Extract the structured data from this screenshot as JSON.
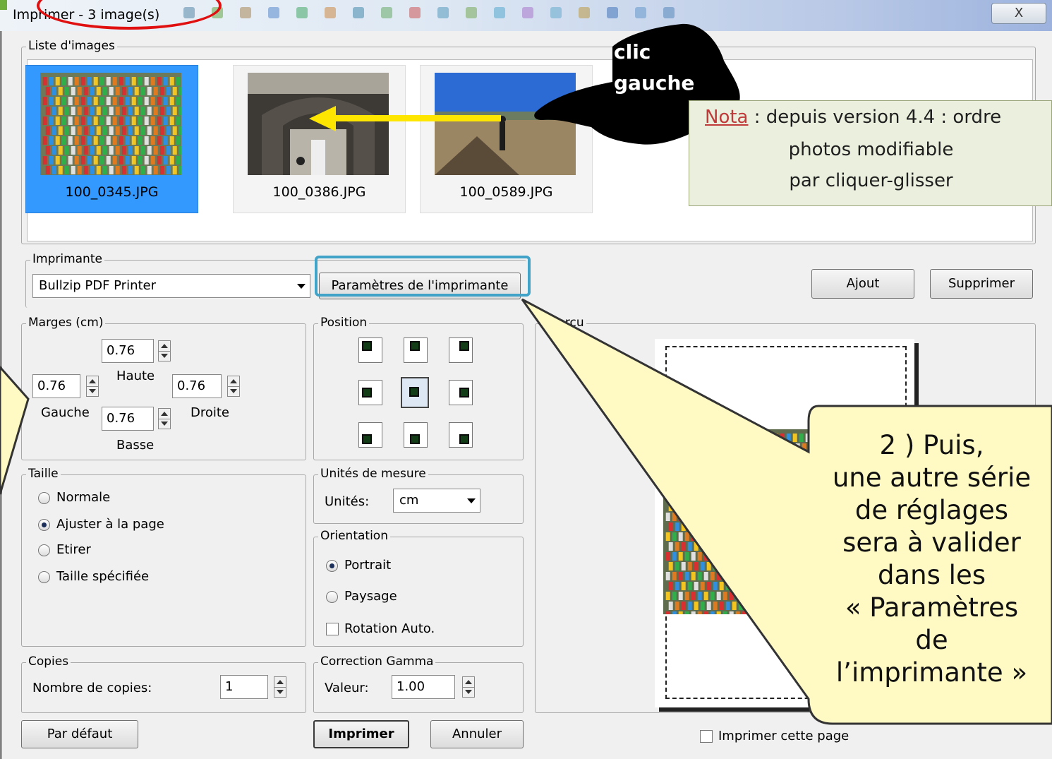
{
  "window": {
    "title": "Imprimer - 3 image(s)",
    "close_label": "X"
  },
  "image_list": {
    "legend": "Liste d'images",
    "items": [
      {
        "filename": "100_0345.JPG",
        "selected": true
      },
      {
        "filename": "100_0386.JPG",
        "selected": false
      },
      {
        "filename": "100_0589.JPG",
        "selected": false
      }
    ]
  },
  "annotations": {
    "hand_line1": "clic",
    "hand_line2": "gauche",
    "nota_label": "Nota",
    "nota_line1": " : depuis version 4.4 : ordre",
    "nota_line2": "photos modifiable",
    "nota_line3": "par cliquer-glisser",
    "bubble_lines": [
      "2 ) Puis,",
      "une autre série",
      "de réglages",
      "sera à valider",
      "dans les",
      "« Paramètres",
      "de",
      "l’imprimante »"
    ]
  },
  "printer": {
    "legend": "Imprimante",
    "selected": "Bullzip PDF Printer",
    "params_button": "Paramètres de l'imprimante",
    "add_button": "Ajout",
    "remove_button": "Supprimer"
  },
  "margins": {
    "legend": "Marges (cm)",
    "top_value": "0.76",
    "top_label": "Haute",
    "left_value": "0.76",
    "left_label": "Gauche",
    "right_value": "0.76",
    "right_label": "Droite",
    "bottom_value": "0.76",
    "bottom_label": "Basse"
  },
  "position": {
    "legend": "Position",
    "selected": "center"
  },
  "size": {
    "legend": "Taille",
    "options": [
      "Normale",
      "Ajuster à la page",
      "Etirer",
      "Taille spécifiée"
    ],
    "selected": "Ajuster à la page"
  },
  "units": {
    "legend": "Unités de mesure",
    "label": "Unités:",
    "value": "cm"
  },
  "orientation": {
    "legend": "Orientation",
    "portrait": "Portrait",
    "landscape": "Paysage",
    "auto_rotate": "Rotation Auto.",
    "selected": "Portrait"
  },
  "copies": {
    "legend": "Copies",
    "label": "Nombre de copies:",
    "value": "1"
  },
  "gamma": {
    "legend": "Correction Gamma",
    "label": "Valeur:",
    "value": "1.00"
  },
  "preview": {
    "legend": "Aperçu",
    "print_page_label": "Imprimer cette page"
  },
  "footer": {
    "default_button": "Par défaut",
    "print_button": "Imprimer",
    "cancel_button": "Annuler"
  },
  "colors": {
    "selection": "#3399ff",
    "highlight_circle": "#e01010",
    "highlight_box": "#42a3c8",
    "arrow": "#ffe600",
    "bubble_fill": "#fff9c4",
    "nota_fill": "#ebf0de"
  }
}
